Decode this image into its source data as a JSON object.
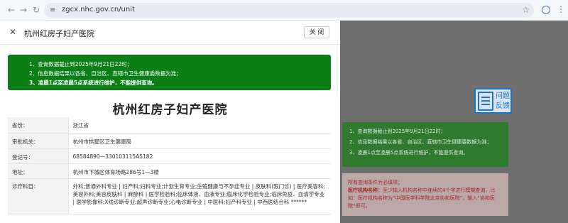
{
  "browser": {
    "url": "zgcx.nhc.gov.cn/unit",
    "back_icon": "←",
    "forward_icon": "→",
    "reload_icon": "↻",
    "tune_icon": "≡",
    "star_icon": "☆",
    "menu_icon": "⋮"
  },
  "dialog": {
    "title": "杭州红房子妇产医院",
    "close_icon": "✕",
    "close_button": "关 闭",
    "notice": [
      "1、查询数据截止到2025年9月21日22时；",
      "2、信息数据结果以各省、自治区、直辖市卫生健康委数据为准；",
      "3、凌晨1点至凌晨5点系统进行维护，不能提供查询。"
    ],
    "hospital_name": "杭州红房子妇产医院",
    "rows": [
      {
        "label": "省份：",
        "value": "浙江省"
      },
      {
        "label": "审批机关：",
        "value": "杭州市拱墅区卫生健康局"
      },
      {
        "label": "登记号：",
        "value": "68584890—330103115A5182"
      },
      {
        "label": "地址：",
        "value": "杭州市下城区体育场路286号1—3楼"
      },
      {
        "label": "诊疗科目：",
        "value": "外科;普通外科专业 | 妇产科;妇科专业;计划生育专业;生殖健康与不孕症专业 | 皮肤科(限门诊) | 医疗美容科;美容外科;美容皮肤科 | 麻醉科 | 医学检验科;临床体液、血液专业;临床化学检验专业;临床免疫、血清学专业 | 医学影像科;X线诊断专业;超声诊断专业;心电诊断专业 | 中医科;妇产科专业 | 中西医结合科 ******"
      }
    ]
  },
  "background": {
    "feedback_line1": "问题",
    "feedback_line2": "反馈",
    "notice": [
      "1、查询数据截止到2025年9月21日22时；",
      "2、信息数据结果以各省、自治区、直辖市卫生健康委数据为准；",
      "3、凌晨1点至凌晨5点系统进行维护，不能提供查询。"
    ],
    "hint_title": "所有查询条件为必填项；",
    "hint_label": "医疗机构名称：",
    "hint_text": "至少输入机构名称中连续的4个字进行模糊查询。比如：医疗机构名称为“中国医学科学院北京协和医院”，输入“协和医院”即可。"
  },
  "colors": {
    "notice_green": "#0b7e15",
    "overlay": "#6f6f6f",
    "feedback_blue": "#1b74c8"
  }
}
